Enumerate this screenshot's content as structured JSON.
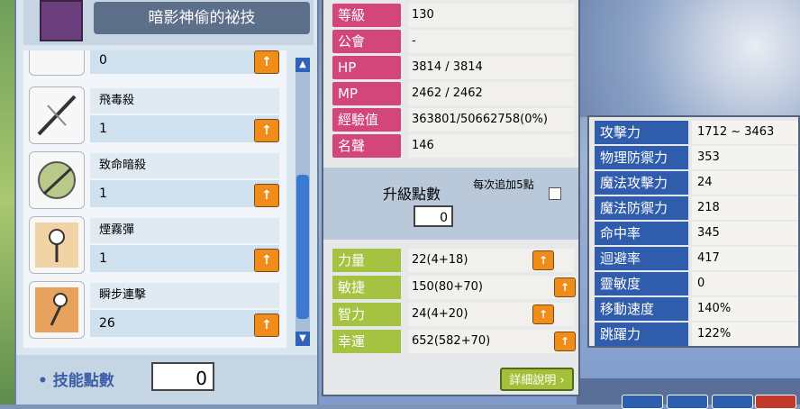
{
  "skill_book": {
    "title": "暗影神偷的祕技"
  },
  "skills": [
    {
      "name": "",
      "level": "0",
      "icon": "scroll-icon"
    },
    {
      "name": "飛毒殺",
      "level": "1",
      "icon": "throwing-star-icon"
    },
    {
      "name": "致命暗殺",
      "level": "1",
      "icon": "assassinate-icon"
    },
    {
      "name": "煙霧彈",
      "level": "1",
      "icon": "smoke-bomb-icon"
    },
    {
      "name": "瞬步連擊",
      "level": "26",
      "icon": "dash-attack-icon"
    }
  ],
  "skill_points": {
    "label": "技能點數",
    "value": "0"
  },
  "upgrade_symbol": "↑",
  "scroll": {
    "up": "▲",
    "down": "▼"
  },
  "stats": [
    {
      "label": "等級",
      "value": "130"
    },
    {
      "label": "公會",
      "value": "-"
    },
    {
      "label": "HP",
      "value": "3814 / 3814"
    },
    {
      "label": "MP",
      "value": "2462 / 2462"
    },
    {
      "label": "經驗值",
      "value": "363801/50662758(0%)"
    },
    {
      "label": "名聲",
      "value": "146"
    }
  ],
  "ability_points": {
    "label": "升級點數",
    "value": "0",
    "auto_label": "每次追加5點"
  },
  "attributes": [
    {
      "label": "力量",
      "value": "22(4+18)"
    },
    {
      "label": "敏捷",
      "value": "150(80+70)"
    },
    {
      "label": "智力",
      "value": "24(4+20)"
    },
    {
      "label": "幸運",
      "value": "652(582+70)"
    }
  ],
  "detail_button": "詳細說明 ›",
  "details": [
    {
      "label": "攻擊力",
      "value": "1712 ~ 3463"
    },
    {
      "label": "物理防禦力",
      "value": "353"
    },
    {
      "label": "魔法攻擊力",
      "value": "24"
    },
    {
      "label": "魔法防禦力",
      "value": "218"
    },
    {
      "label": "命中率",
      "value": "345"
    },
    {
      "label": "迴避率",
      "value": "417"
    },
    {
      "label": "靈敏度",
      "value": "0"
    },
    {
      "label": "移動速度",
      "value": "140%"
    },
    {
      "label": "跳躍力",
      "value": "122%"
    }
  ],
  "colors": {
    "stat_label": "#d2467a",
    "attr_label": "#a5c240",
    "detail_label": "#2f5cab",
    "upgrade": "#f08c1a"
  }
}
